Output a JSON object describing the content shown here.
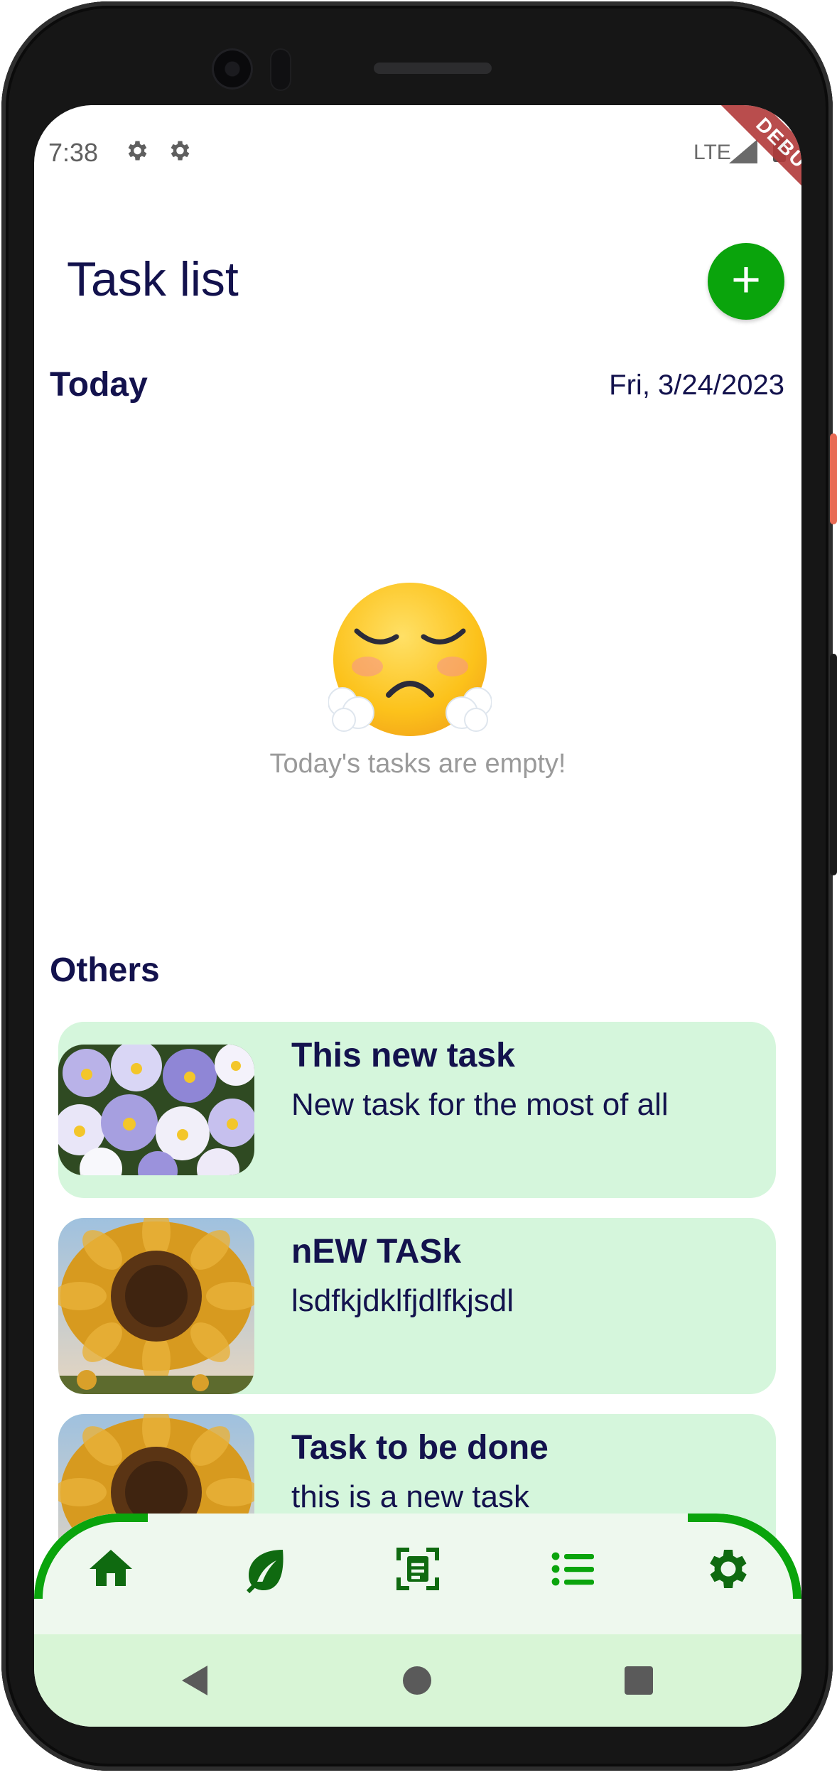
{
  "status_bar": {
    "time": "7:38",
    "network": "LTE",
    "debug_label": "DEBUG"
  },
  "header": {
    "title": "Task list",
    "add_label": "+"
  },
  "today": {
    "label": "Today",
    "date": "Fri, 3/24/2023",
    "empty_message": "Today's tasks are empty!"
  },
  "others": {
    "label": "Others",
    "tasks": [
      {
        "title": "This new task",
        "description": "New task for the most of all",
        "image": "pansies"
      },
      {
        "title": "nEW TASk",
        "description": "lsdfkjdklfjdlfkjsdl",
        "image": "sunflower"
      },
      {
        "title": "Task to be done",
        "description": "this is a new task",
        "image": "sunflower"
      }
    ]
  },
  "bottom_nav": {
    "items": [
      {
        "icon": "home-icon"
      },
      {
        "icon": "leaf-icon"
      },
      {
        "icon": "scan-document-icon"
      },
      {
        "icon": "list-icon"
      },
      {
        "icon": "settings-icon"
      }
    ]
  },
  "colors": {
    "accent": "#0aa40c",
    "text": "#13124d",
    "card": "#d5f6dc",
    "nav": "#eef8ee",
    "system_nav": "#d8f5d6"
  }
}
